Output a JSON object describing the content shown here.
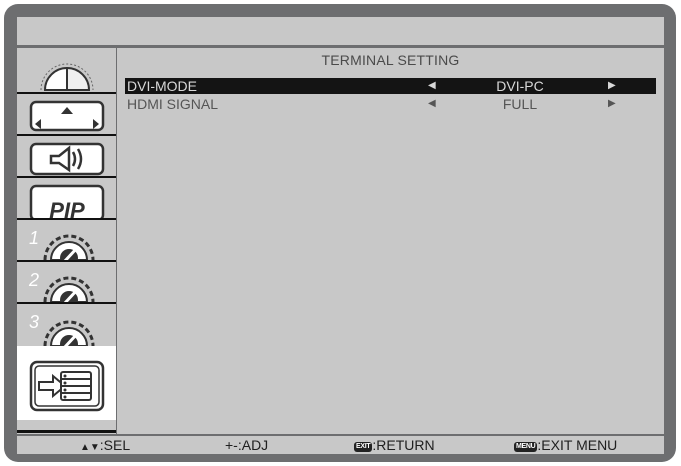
{
  "menu": {
    "title": "TERMINAL SETTING",
    "rows": [
      {
        "label": "DVI-MODE",
        "value": "DVI-PC",
        "selected": true
      },
      {
        "label": "HDMI SIGNAL",
        "value": "FULL",
        "selected": false
      }
    ]
  },
  "sidebar": {
    "items": [
      {
        "icon": "picture-icon"
      },
      {
        "icon": "screen-icon"
      },
      {
        "icon": "audio-icon"
      },
      {
        "icon": "pip-icon",
        "label": "PIP"
      },
      {
        "icon": "configuration-1-icon",
        "label": "1"
      },
      {
        "icon": "configuration-2-icon",
        "label": "2"
      },
      {
        "icon": "configuration-3-icon",
        "label": "3"
      },
      {
        "icon": "input-icon",
        "active": true
      }
    ]
  },
  "footer": {
    "select": ":SEL",
    "adjust": "+-:ADJ",
    "exit_key": "EXIT",
    "return": ":RETURN",
    "menu_key": "MENU",
    "exit_menu": ":EXIT MENU"
  },
  "colors": {
    "frame": "#6d6e70",
    "panel": "#c8c8c8",
    "selected_row": "#141414",
    "active_tab": "#ffffff"
  }
}
